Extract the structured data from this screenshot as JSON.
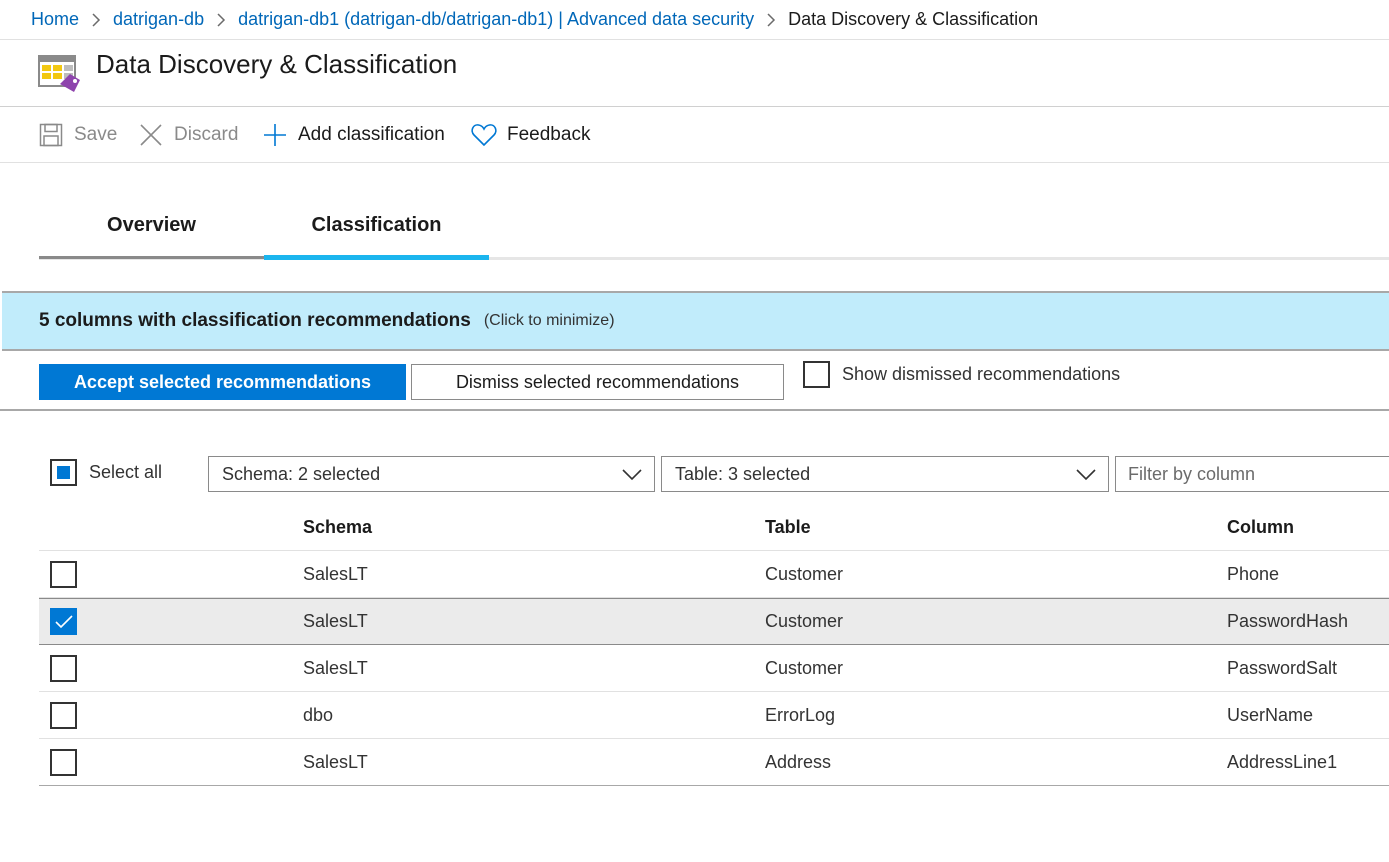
{
  "breadcrumb": {
    "items": [
      "Home",
      "datrigan-db",
      "datrigan-db1 (datrigan-db/datrigan-db1) | Advanced data security"
    ],
    "current": "Data Discovery & Classification"
  },
  "page": {
    "title": "Data Discovery & Classification",
    "icon": "data-classification-icon"
  },
  "toolbar": {
    "save_label": "Save",
    "discard_label": "Discard",
    "add_label": "Add classification",
    "feedback_label": "Feedback"
  },
  "tabs": [
    {
      "label": "Overview",
      "active": false
    },
    {
      "label": "Classification",
      "active": true
    }
  ],
  "banner": {
    "title": "5 columns with classification recommendations",
    "hint": "(Click to minimize)"
  },
  "actions": {
    "accept_label": "Accept selected recommendations",
    "dismiss_label": "Dismiss selected recommendations",
    "show_dismissed_label": "Show dismissed recommendations",
    "show_dismissed_checked": false
  },
  "filters": {
    "select_all_label": "Select all",
    "schema_value": "Schema: 2 selected",
    "table_value": "Table: 3 selected",
    "column_placeholder": "Filter by column"
  },
  "grid": {
    "headers": {
      "schema": "Schema",
      "table": "Table",
      "column": "Column"
    },
    "rows": [
      {
        "schema": "SalesLT",
        "table": "Customer",
        "column": "Phone",
        "checked": false
      },
      {
        "schema": "SalesLT",
        "table": "Customer",
        "column": "PasswordHash",
        "checked": true
      },
      {
        "schema": "SalesLT",
        "table": "Customer",
        "column": "PasswordSalt",
        "checked": false
      },
      {
        "schema": "dbo",
        "table": "ErrorLog",
        "column": "UserName",
        "checked": false
      },
      {
        "schema": "SalesLT",
        "table": "Address",
        "column": "AddressLine1",
        "checked": false
      }
    ]
  },
  "colors": {
    "link": "#0067b8",
    "primary": "#0078d4",
    "tab_active": "#1bb5ee",
    "banner_bg": "#c1ecfb",
    "row_selected": "#ebebeb"
  }
}
